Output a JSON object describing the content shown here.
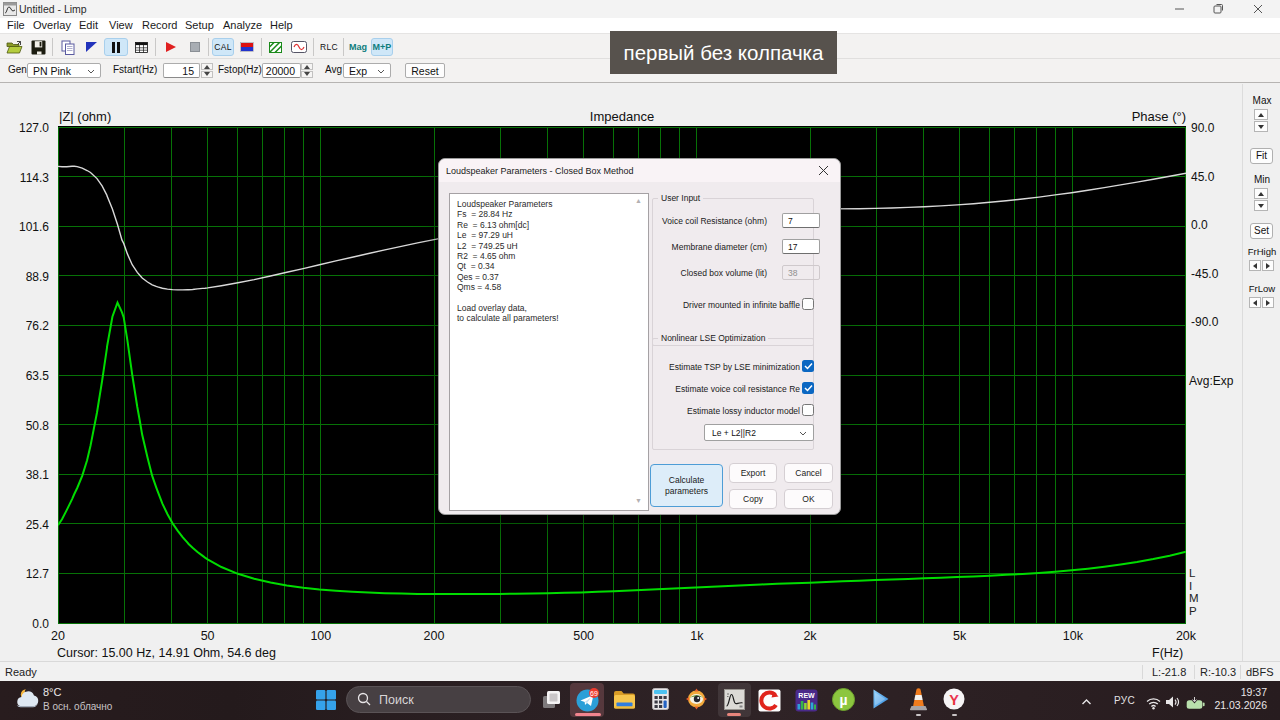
{
  "window": {
    "title": "Untitled - Limp"
  },
  "menu": {
    "items": [
      "File",
      "Overlay",
      "Edit",
      "View",
      "Record",
      "Setup",
      "Analyze",
      "Help"
    ]
  },
  "toolbar": {
    "cal": "CAL",
    "rlc": "RLC",
    "mag": "Mag",
    "mp": "M+P"
  },
  "genbar": {
    "gen_label": "Gen",
    "gen_value": "PN Pink",
    "fstart_label": "Fstart(Hz)",
    "fstart_value": "15",
    "fstop_label": "Fstop(Hz)",
    "fstop_value": "20000",
    "avg_label": "Avg",
    "avg_value": "Exp",
    "reset_label": "Reset"
  },
  "note": {
    "text": "первый без колпачка"
  },
  "side": {
    "max": "Max",
    "fit": "Fit",
    "min": "Min",
    "set": "Set",
    "frhigh": "FrHigh",
    "frlow": "FrLow"
  },
  "chart": {
    "title": "Impedance",
    "ylabel": "|Z| (ohm)",
    "ylabel_right": "Phase (°)",
    "xlabel": "F(Hz)",
    "avg": "Avg:Exp",
    "watermark": "LIMP",
    "cursor": "Cursor: 15.00 Hz, 14.91 Ohm, 54.6 deg",
    "chart_data": {
      "type": "line",
      "title": "Impedance",
      "x_scale": "log",
      "xlim": [
        20,
        20000
      ],
      "xticks": [
        {
          "f": 20,
          "label": "20"
        },
        {
          "f": 50,
          "label": "50"
        },
        {
          "f": 100,
          "label": "100"
        },
        {
          "f": 200,
          "label": "200"
        },
        {
          "f": 500,
          "label": "500"
        },
        {
          "f": 1000,
          "label": "1k"
        },
        {
          "f": 2000,
          "label": "2k"
        },
        {
          "f": 5000,
          "label": "5k"
        },
        {
          "f": 10000,
          "label": "10k"
        },
        {
          "f": 20000,
          "label": "20k"
        }
      ],
      "left_axis": {
        "label": "|Z| (ohm)",
        "lim": [
          0,
          127
        ],
        "ticks": [
          "127.0",
          "114.3",
          "101.6",
          "88.9",
          "76.2",
          "63.5",
          "50.8",
          "38.1",
          "25.4",
          "12.7",
          "0.0"
        ]
      },
      "right_axis": {
        "label": "Phase (°)",
        "lim": [
          90,
          -90
        ],
        "ticks": [
          "90.0",
          "45.0",
          "0.0",
          "-45.0",
          "-90.0"
        ]
      },
      "grid_color": "#077207",
      "bg": "#000000",
      "f": [
        20.0,
        20.5,
        21.1,
        21.8,
        22.1,
        22.5,
        23.2,
        23.9,
        24.4,
        24.6,
        25.4,
        26.2,
        27.0,
        27.0,
        27.9,
        28.8,
        29.6,
        29.9,
        30.6,
        31.5,
        32.5,
        33.0,
        33.5,
        34.6,
        35.6,
        36.5,
        36.8,
        37.9,
        39.1,
        40.3,
        40.3,
        41.6,
        42.9,
        44.2,
        44.5,
        45.6,
        47.0,
        48.5,
        49.2,
        50.0,
        54.4,
        60.2,
        66.5,
        73.5,
        81.2,
        89.8,
        99.2,
        109.7,
        121.2,
        134.0,
        148.1,
        163.7,
        180.9,
        200.0,
        221.1,
        244.3,
        270.1,
        298.5,
        329.9,
        364.7,
        403.1,
        445.5,
        492.4,
        544.3,
        601.6,
        664.9,
        734.9,
        812.3,
        897.9,
        992.4,
        1096.9,
        1212.4,
        1340.0,
        1481.1,
        1637.1,
        1809.5,
        2000.0,
        2210.6,
        2443.3,
        2700.6,
        2985.0,
        3299.3,
        3646.7,
        4030.7,
        4455.1,
        4924.2,
        5442.7,
        6015.8,
        6649.2,
        7349.3,
        8123.2,
        8978.5,
        9923.9,
        10968.8,
        12123.8,
        13400.4,
        14811.4,
        16370.9,
        18094.7,
        20000.0
      ],
      "series": [
        {
          "name": "Impedance magnitude",
          "unit": "ohm",
          "axis": "left",
          "color": "#00dc00",
          "values": [
            25.02,
            26.55,
            28.91,
            31.72,
            33.04,
            34.57,
            37.67,
            41.68,
            45.37,
            47.1,
            53.9,
            62.01,
            70.48,
            70.69,
            78.44,
            82.03,
            79.53,
            78.25,
            72.39,
            63.57,
            55.31,
            51.77,
            48.2,
            42.41,
            37.66,
            34.71,
            33.74,
            30.55,
            27.85,
            25.6,
            25.59,
            23.65,
            21.99,
            20.56,
            20.23,
            19.29,
            18.18,
            17.19,
            16.74,
            16.32,
            14.34,
            12.61,
            11.33,
            10.36,
            9.61,
            9.03,
            8.59,
            8.24,
            7.98,
            7.78,
            7.64,
            7.53,
            7.46,
            7.42,
            7.4,
            7.39,
            7.41,
            7.44,
            7.48,
            7.55,
            7.63,
            7.73,
            7.84,
            7.98,
            8.13,
            8.3,
            8.49,
            8.68,
            8.89,
            9.09,
            9.3,
            9.49,
            9.69,
            9.87,
            10.03,
            10.19,
            10.33,
            10.51,
            10.67,
            10.83,
            10.99,
            11.14,
            11.29,
            11.44,
            11.59,
            11.75,
            11.93,
            12.12,
            12.33,
            12.56,
            12.83,
            13.14,
            13.5,
            13.91,
            14.39,
            14.95,
            15.6,
            16.36,
            17.24,
            18.26
          ]
        },
        {
          "name": "Phase",
          "unit": "deg",
          "axis": "right",
          "color": "#d9d9d9",
          "values": [
            55.5,
            55.1,
            55.2,
            55.7,
            55.7,
            55.3,
            53.8,
            51.7,
            49.8,
            48.7,
            44.2,
            37.4,
            28.5,
            28.2,
            16.0,
            1.6,
            -13.0,
            -16.0,
            -25.7,
            -35.7,
            -42.9,
            -45.6,
            -48.1,
            -51.8,
            -54.4,
            -55.9,
            -56.3,
            -57.5,
            -58.4,
            -58.8,
            -58.8,
            -59.1,
            -59.1,
            -58.9,
            -58.9,
            -58.7,
            -58.2,
            -57.7,
            -57.5,
            -57.2,
            -55.2,
            -52.5,
            -49.5,
            -46.2,
            -42.8,
            -39.3,
            -35.8,
            -32.2,
            -28.8,
            -25.3,
            -22.0,
            -18.7,
            -15.5,
            -12.4,
            -9.5,
            -6.6,
            -3.9,
            -1.3,
            1.2,
            3.5,
            5.7,
            7.7,
            9.5,
            11.1,
            12.5,
            13.6,
            14.6,
            15.3,
            15.8,
            16.1,
            16.3,
            16.4,
            16.4,
            16.3,
            16.2,
            16.1,
            16.0,
            16.0,
            16.1,
            16.2,
            16.5,
            16.9,
            17.4,
            18.0,
            18.8,
            19.8,
            20.9,
            22.2,
            23.6,
            25.2,
            27.0,
            29.0,
            31.1,
            33.4,
            35.8,
            38.3,
            40.9,
            43.6,
            46.4,
            49.1
          ]
        }
      ]
    }
  },
  "dialog": {
    "title": "Loudspeaker Parameters - Closed Box Method",
    "listbox": [
      "Loudspeaker Parameters",
      "Fs  = 28.84 Hz",
      "Re  = 6.13 ohm[dc]",
      "Le  = 97.29 uH",
      "L2  = 749.25 uH",
      "R2  = 4.65 ohm",
      "Qt  = 0.34",
      "Qes = 0.37",
      "Qms = 4.58",
      "",
      "Load overlay data,",
      "to calculate all parameters!"
    ],
    "user_input": {
      "legend": "User Input",
      "rows": [
        {
          "label": "Voice coil Resistance (ohm)",
          "value": "7",
          "disabled": false
        },
        {
          "label": "Membrane diameter (cm)",
          "value": "17",
          "disabled": false
        },
        {
          "label": "Closed box volume (lit)",
          "value": "38",
          "disabled": true
        }
      ],
      "baffle_label": "Driver mounted in infinite baffle"
    },
    "lse": {
      "legend": "Nonlinear LSE Optimization",
      "checks": [
        {
          "label": "Estimate TSP by LSE minimization",
          "checked": true
        },
        {
          "label": "Estimate voice coil resistance Re",
          "checked": true
        },
        {
          "label": "Estimate lossy inductor model",
          "checked": false
        }
      ],
      "combo_value": "Le + L2||R2"
    },
    "buttons": {
      "calculate": "Calculate\nparameters",
      "export": "Export",
      "cancel": "Cancel",
      "copy": "Copy",
      "ok": "OK"
    }
  },
  "status": {
    "ready": "Ready",
    "l": "L:-21.8",
    "r": "R:-10.3",
    "unit": "dBFS"
  },
  "taskbar": {
    "weather_temp": "8°C",
    "weather_desc": "В осн. облачно",
    "search": "Поиск",
    "badge": "69",
    "rew": "REW",
    "lang": "РУС",
    "time": "19:37",
    "date": "21.03.2026"
  },
  "colors": {
    "accent_blue": "#0b67c2",
    "toolbar_highlight": "#cfe7f8",
    "grid_green": "#087c08",
    "impedance_green": "#00dc00",
    "phase_gray": "#d9d9d9",
    "taskbar_dark": "#241a1d"
  }
}
